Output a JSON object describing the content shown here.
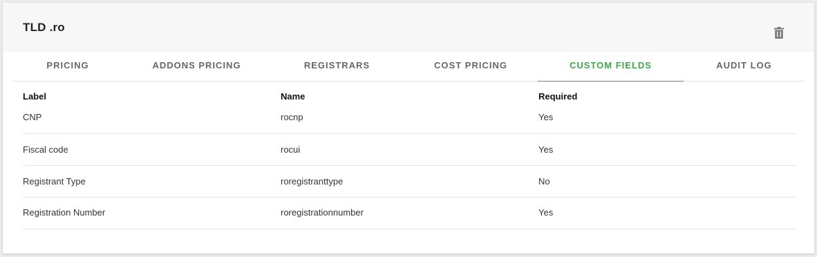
{
  "header": {
    "title": "TLD .ro",
    "delete_icon": "trash-icon"
  },
  "tabs": [
    {
      "label": "PRICING",
      "active": false
    },
    {
      "label": "ADDONS PRICING",
      "active": false
    },
    {
      "label": "REGISTRARS",
      "active": false
    },
    {
      "label": "COST PRICING",
      "active": false
    },
    {
      "label": "CUSTOM FIELDS",
      "active": true
    },
    {
      "label": "AUDIT LOG",
      "active": false
    }
  ],
  "table": {
    "columns": [
      "Label",
      "Name",
      "Required"
    ],
    "rows": [
      {
        "label": "CNP",
        "name": "rocnp",
        "required": "Yes"
      },
      {
        "label": "Fiscal code",
        "name": "rocui",
        "required": "Yes"
      },
      {
        "label": "Registrant Type",
        "name": "roregistranttype",
        "required": "No"
      },
      {
        "label": "Registration Number",
        "name": "roregistrationnumber",
        "required": "Yes"
      }
    ]
  },
  "colors": {
    "accent": "#3fa64a",
    "header_bg": "#f7f7f7",
    "page_bg": "#ececec"
  }
}
